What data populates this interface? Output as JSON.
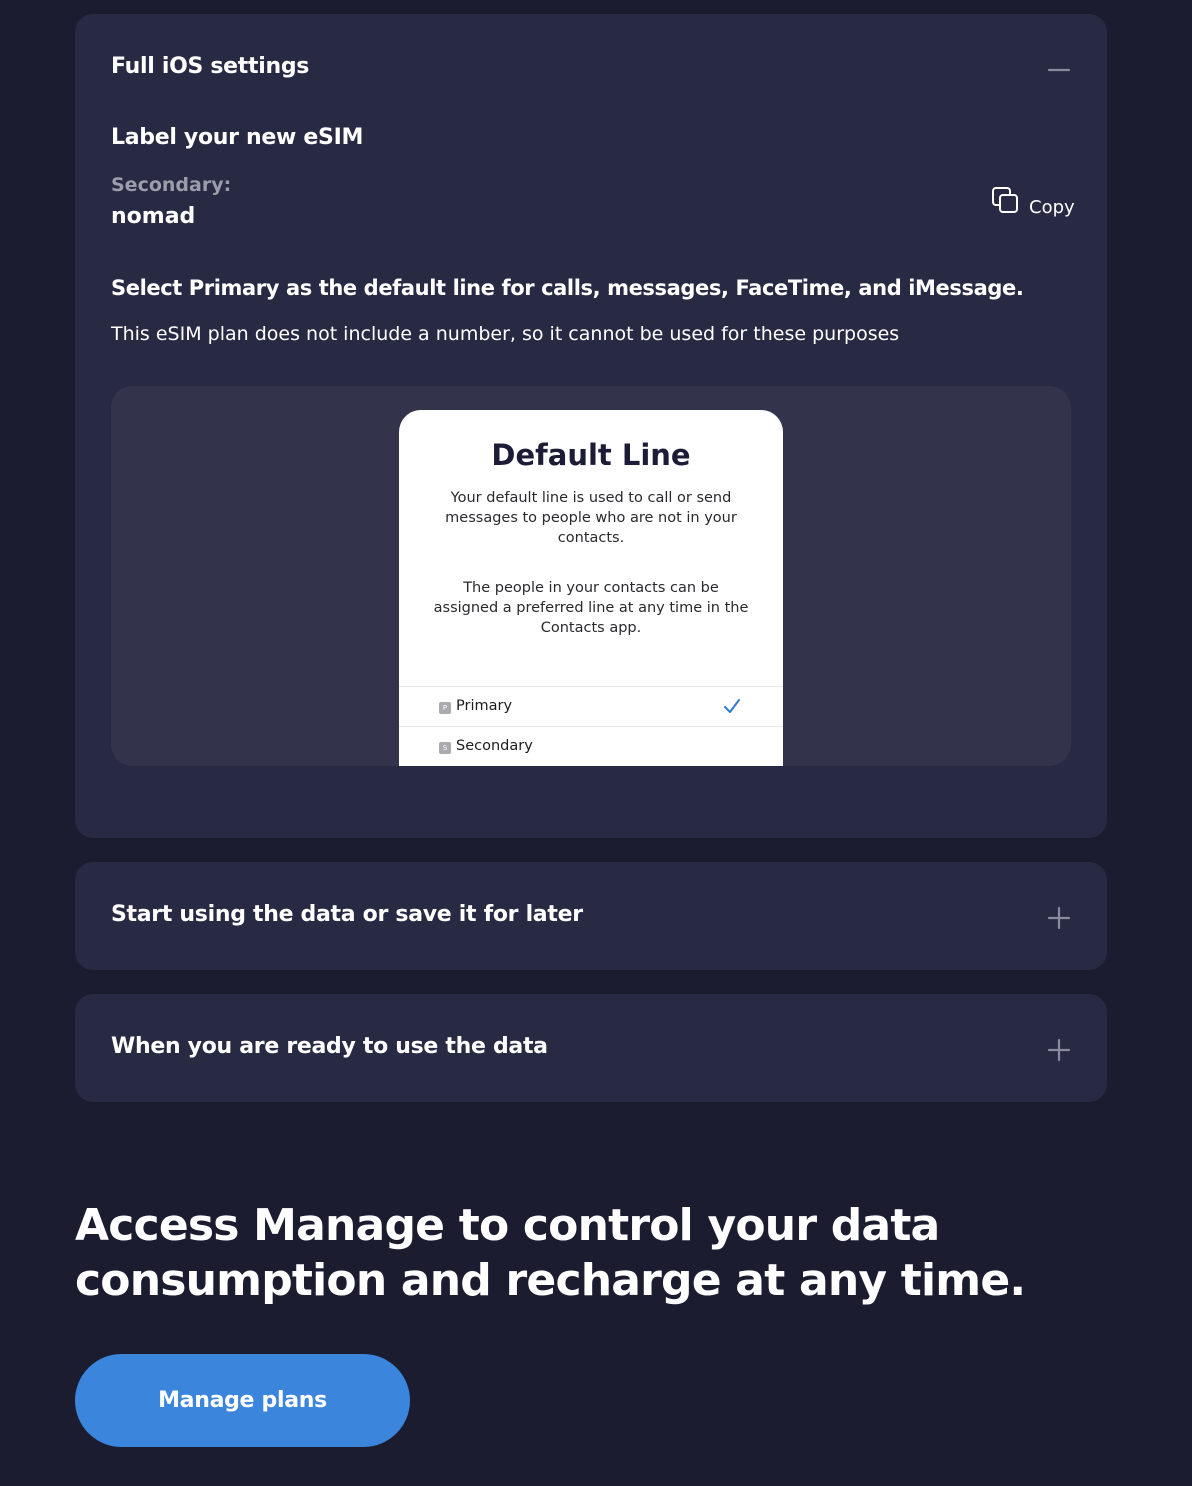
{
  "accordion": {
    "open_section": {
      "title": "Full iOS settings",
      "toggle_icon": "minus-icon",
      "label_heading": "Label your new eSIM",
      "secondary_label": "Secondary:",
      "secondary_value": "nomad",
      "copy_label": "Copy",
      "copy_icon": "copy-icon",
      "select_heading": "Select Primary as the default line for calls, messages, FaceTime, and iMessage.",
      "select_description": "This eSIM plan does not include a number, so it cannot be used for these purposes",
      "screenshot": {
        "title": "Default Line",
        "paragraph_1": "Your default line is used to call or send messages to people who are not in your contacts.",
        "paragraph_2": "The people in your contacts can be assigned a preferred line at any time in the Contacts app.",
        "lines": [
          {
            "badge": "P",
            "label": "Primary",
            "selected": true
          },
          {
            "badge": "S",
            "label": "Secondary",
            "selected": false
          }
        ]
      }
    },
    "collapsed_sections": [
      {
        "title": "Start using the data or save it for later",
        "toggle_icon": "plus-icon"
      },
      {
        "title": "When you are ready to use the data",
        "toggle_icon": "plus-icon"
      }
    ]
  },
  "manage": {
    "heading": "Access Manage to control your data consumption and recharge at any time.",
    "button_label": "Manage plans"
  },
  "colors": {
    "background": "#1b1c30",
    "panel": "#282a44",
    "preview": "#33344c",
    "accent": "#3b86dc",
    "muted_text": "#9c9daa"
  }
}
